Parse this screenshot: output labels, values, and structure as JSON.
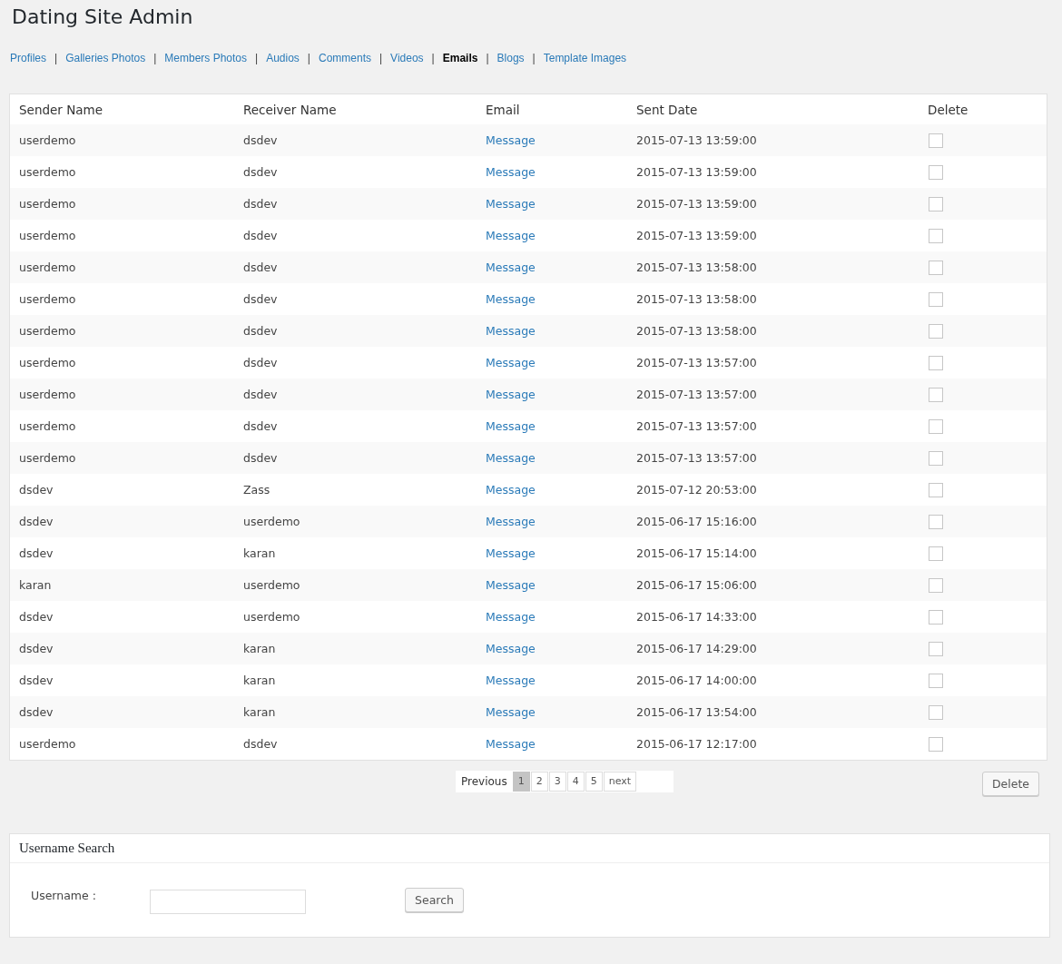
{
  "page_title": "Dating Site Admin",
  "nav": [
    {
      "kind": "link",
      "label": "Profiles",
      "selected": false
    },
    {
      "kind": "separator",
      "label": "|"
    },
    {
      "kind": "link",
      "label": "Galleries Photos",
      "selected": false
    },
    {
      "kind": "separator",
      "label": "|"
    },
    {
      "kind": "link",
      "label": "Members Photos",
      "selected": false
    },
    {
      "kind": "separator",
      "label": "|"
    },
    {
      "kind": "link",
      "label": "Audios",
      "selected": false
    },
    {
      "kind": "separator",
      "label": "|"
    },
    {
      "kind": "link",
      "label": "Comments",
      "selected": false
    },
    {
      "kind": "separator",
      "label": "|"
    },
    {
      "kind": "link",
      "label": "Videos",
      "selected": false
    },
    {
      "kind": "separator",
      "label": "|"
    },
    {
      "kind": "link",
      "label": "Emails",
      "selected": true
    },
    {
      "kind": "separator",
      "label": "|"
    },
    {
      "kind": "link",
      "label": "Blogs",
      "selected": false
    },
    {
      "kind": "separator",
      "label": "|"
    },
    {
      "kind": "link",
      "label": "Template Images",
      "selected": false
    }
  ],
  "table": {
    "columns": [
      "Sender Name",
      "Receiver Name",
      "Email",
      "Sent Date",
      "Delete"
    ],
    "rows": [
      {
        "sender": "userdemo",
        "receiver": "dsdev",
        "email": "Message",
        "sent": "2015-07-13 13:59:00",
        "checked": false
      },
      {
        "sender": "userdemo",
        "receiver": "dsdev",
        "email": "Message",
        "sent": "2015-07-13 13:59:00",
        "checked": false
      },
      {
        "sender": "userdemo",
        "receiver": "dsdev",
        "email": "Message",
        "sent": "2015-07-13 13:59:00",
        "checked": false
      },
      {
        "sender": "userdemo",
        "receiver": "dsdev",
        "email": "Message",
        "sent": "2015-07-13 13:59:00",
        "checked": false
      },
      {
        "sender": "userdemo",
        "receiver": "dsdev",
        "email": "Message",
        "sent": "2015-07-13 13:58:00",
        "checked": false
      },
      {
        "sender": "userdemo",
        "receiver": "dsdev",
        "email": "Message",
        "sent": "2015-07-13 13:58:00",
        "checked": false
      },
      {
        "sender": "userdemo",
        "receiver": "dsdev",
        "email": "Message",
        "sent": "2015-07-13 13:58:00",
        "checked": false
      },
      {
        "sender": "userdemo",
        "receiver": "dsdev",
        "email": "Message",
        "sent": "2015-07-13 13:57:00",
        "checked": false
      },
      {
        "sender": "userdemo",
        "receiver": "dsdev",
        "email": "Message",
        "sent": "2015-07-13 13:57:00",
        "checked": false
      },
      {
        "sender": "userdemo",
        "receiver": "dsdev",
        "email": "Message",
        "sent": "2015-07-13 13:57:00",
        "checked": false
      },
      {
        "sender": "userdemo",
        "receiver": "dsdev",
        "email": "Message",
        "sent": "2015-07-13 13:57:00",
        "checked": false
      },
      {
        "sender": "dsdev",
        "receiver": "Zass",
        "email": "Message",
        "sent": "2015-07-12 20:53:00",
        "checked": false
      },
      {
        "sender": "dsdev",
        "receiver": "userdemo",
        "email": "Message",
        "sent": "2015-06-17 15:16:00",
        "checked": false
      },
      {
        "sender": "dsdev",
        "receiver": "karan",
        "email": "Message",
        "sent": "2015-06-17 15:14:00",
        "checked": false
      },
      {
        "sender": "karan",
        "receiver": "userdemo",
        "email": "Message",
        "sent": "2015-06-17 15:06:00",
        "checked": false
      },
      {
        "sender": "dsdev",
        "receiver": "userdemo",
        "email": "Message",
        "sent": "2015-06-17 14:33:00",
        "checked": false
      },
      {
        "sender": "dsdev",
        "receiver": "karan",
        "email": "Message",
        "sent": "2015-06-17 14:29:00",
        "checked": false
      },
      {
        "sender": "dsdev",
        "receiver": "karan",
        "email": "Message",
        "sent": "2015-06-17 14:00:00",
        "checked": false
      },
      {
        "sender": "dsdev",
        "receiver": "karan",
        "email": "Message",
        "sent": "2015-06-17 13:54:00",
        "checked": false
      },
      {
        "sender": "userdemo",
        "receiver": "dsdev",
        "email": "Message",
        "sent": "2015-06-17 12:17:00",
        "checked": false
      }
    ]
  },
  "pagination": {
    "previous": "Previous",
    "pages": [
      {
        "label": "1",
        "selected": true
      },
      {
        "label": "2",
        "selected": false
      },
      {
        "label": "3",
        "selected": false
      },
      {
        "label": "4",
        "selected": false
      },
      {
        "label": "5",
        "selected": false
      }
    ],
    "next": "next"
  },
  "delete_button": "Delete",
  "search_panel": {
    "title": "Username Search",
    "label": "Username :",
    "button": "Search"
  }
}
